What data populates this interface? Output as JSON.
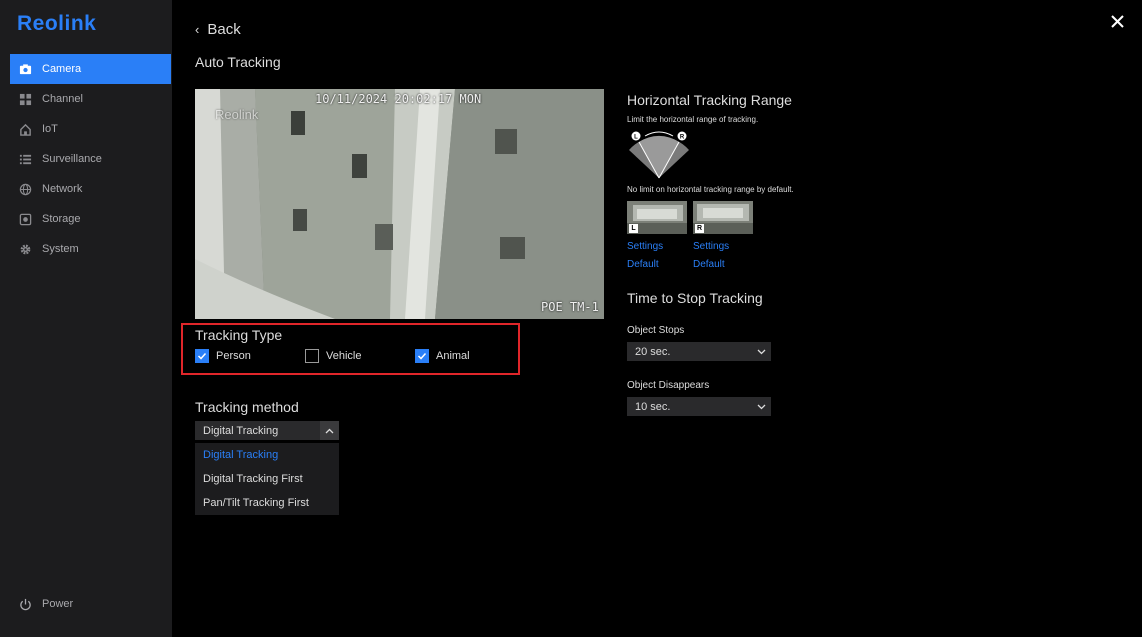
{
  "brand": {
    "logo": "Reolink",
    "accent": "#2a7ff7"
  },
  "sidebar": {
    "items": [
      {
        "label": "Camera",
        "icon": "camera-icon",
        "active": true
      },
      {
        "label": "Channel",
        "icon": "grid-icon"
      },
      {
        "label": "IoT",
        "icon": "home-icon"
      },
      {
        "label": "Surveillance",
        "icon": "list-icon"
      },
      {
        "label": "Network",
        "icon": "globe-icon"
      },
      {
        "label": "Storage",
        "icon": "storage-icon"
      },
      {
        "label": "System",
        "icon": "gear-icon"
      }
    ],
    "power": {
      "label": "Power",
      "icon": "power-icon"
    }
  },
  "header": {
    "back": "Back",
    "title": "Auto Tracking",
    "close_icon": "close-icon"
  },
  "video": {
    "timestamp": "10/11/2024 20:02:17 MON",
    "watermark": "Reolink",
    "channel_name": "POE TM-1"
  },
  "tracking_type": {
    "title": "Tracking Type",
    "options": [
      {
        "label": "Person",
        "checked": true
      },
      {
        "label": "Vehicle",
        "checked": false
      },
      {
        "label": "Animal",
        "checked": true
      }
    ]
  },
  "tracking_method": {
    "title": "Tracking method",
    "selected": "Digital Tracking",
    "options": [
      "Digital Tracking",
      "Digital Tracking First",
      "Pan/Tilt Tracking First"
    ]
  },
  "horizontal_range": {
    "title": "Horizontal Tracking Range",
    "desc": "Limit the horizontal range of tracking.",
    "note": "No limit on horizontal tracking range by default.",
    "left_tag": "L",
    "right_tag": "R",
    "diagram_left": "L",
    "diagram_right": "R",
    "left": {
      "settings": "Settings",
      "default": "Default"
    },
    "right": {
      "settings": "Settings",
      "default": "Default"
    }
  },
  "stop_tracking": {
    "title": "Time to Stop Tracking",
    "object_stops": {
      "label": "Object Stops",
      "value": "20 sec."
    },
    "object_disappears": {
      "label": "Object Disappears",
      "value": "10 sec."
    }
  }
}
